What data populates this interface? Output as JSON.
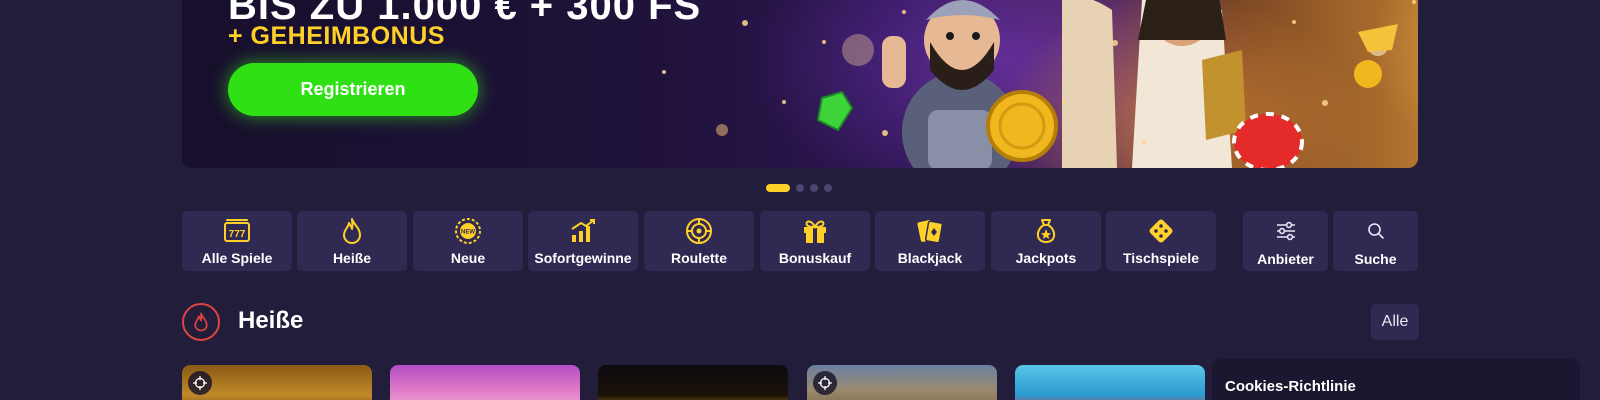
{
  "hero": {
    "headline": "BIS ZU 1.000 € + 300 FS",
    "subline": "+ GEHEIMBONUS",
    "cta_label": "Registrieren"
  },
  "carousel": {
    "slides": 4,
    "active": 1
  },
  "categories": [
    {
      "label": "Alle Spiele",
      "icon": "slot-777-icon"
    },
    {
      "label": "Heiße",
      "icon": "flame-icon"
    },
    {
      "label": "Neue",
      "icon": "new-badge-icon"
    },
    {
      "label": "Sofortgewinne",
      "icon": "bar-chart-icon"
    },
    {
      "label": "Roulette",
      "icon": "roulette-icon"
    },
    {
      "label": "Bonuskauf",
      "icon": "gift-icon"
    },
    {
      "label": "Blackjack",
      "icon": "cards-icon"
    },
    {
      "label": "Jackpots",
      "icon": "money-bag-icon"
    },
    {
      "label": "Tischspiele",
      "icon": "dice-icon"
    }
  ],
  "utilities": [
    {
      "label": "Anbieter",
      "icon": "sliders-icon"
    },
    {
      "label": "Suche",
      "icon": "search-icon"
    }
  ],
  "section": {
    "title": "Heiße",
    "all_label": "Alle",
    "icon": "flame-icon"
  },
  "cookie": {
    "title": "Cookies-Richtlinie"
  },
  "colors": {
    "background": "#221d3b",
    "tile": "#302a52",
    "accent_yellow": "#ffd028",
    "cta_green": "#2fe014",
    "hot_red": "#e0453f"
  }
}
